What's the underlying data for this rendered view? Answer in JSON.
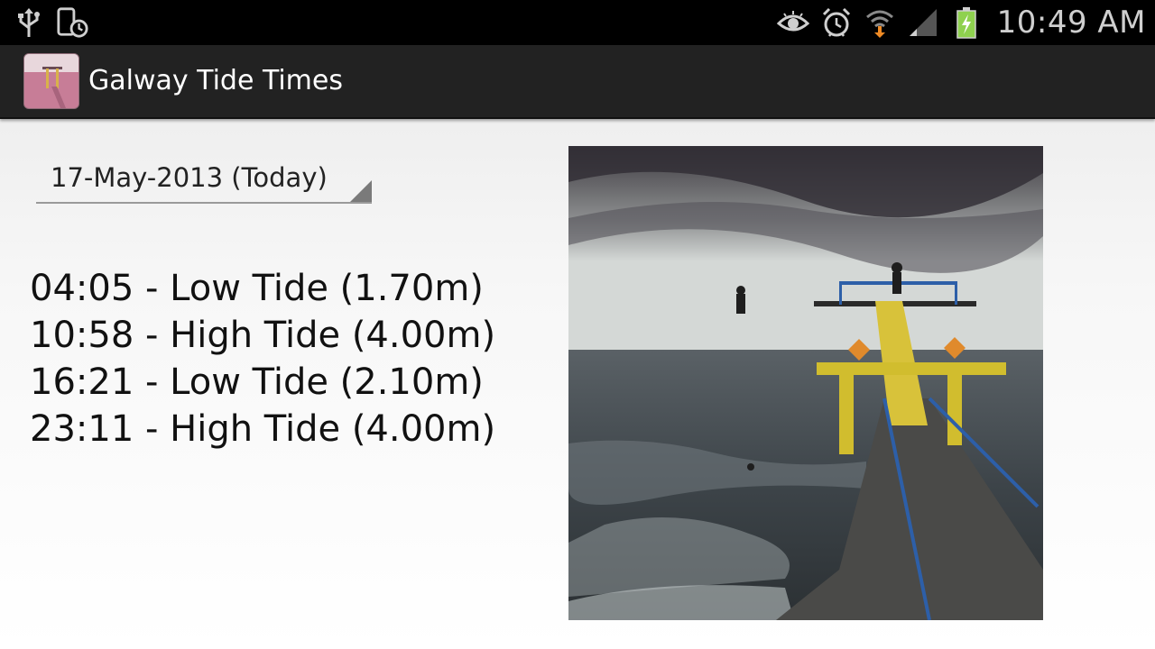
{
  "status_bar": {
    "time": "10:49 AM",
    "icons": [
      "usb-icon",
      "screen-timer-icon",
      "eye-icon",
      "alarm-icon",
      "wifi-download-icon",
      "signal-icon",
      "battery-charging-icon"
    ]
  },
  "action_bar": {
    "title": "Galway Tide Times",
    "app_icon": "pier-photo-app-icon"
  },
  "date_selector": {
    "selected": "17-May-2013 (Today)"
  },
  "tides": [
    "04:05 - Low Tide (1.70m)",
    "10:58 - High Tide (4.00m)",
    "16:21 - Low Tide (2.10m)",
    "23:11 - High Tide (4.00m)"
  ],
  "photo": {
    "subject": "diving-tower-pier-photo"
  },
  "colors": {
    "status_bar_bg": "#000000",
    "action_bar_bg": "#222222",
    "battery_green": "#8fd14f",
    "download_arrow": "#f08a24"
  }
}
